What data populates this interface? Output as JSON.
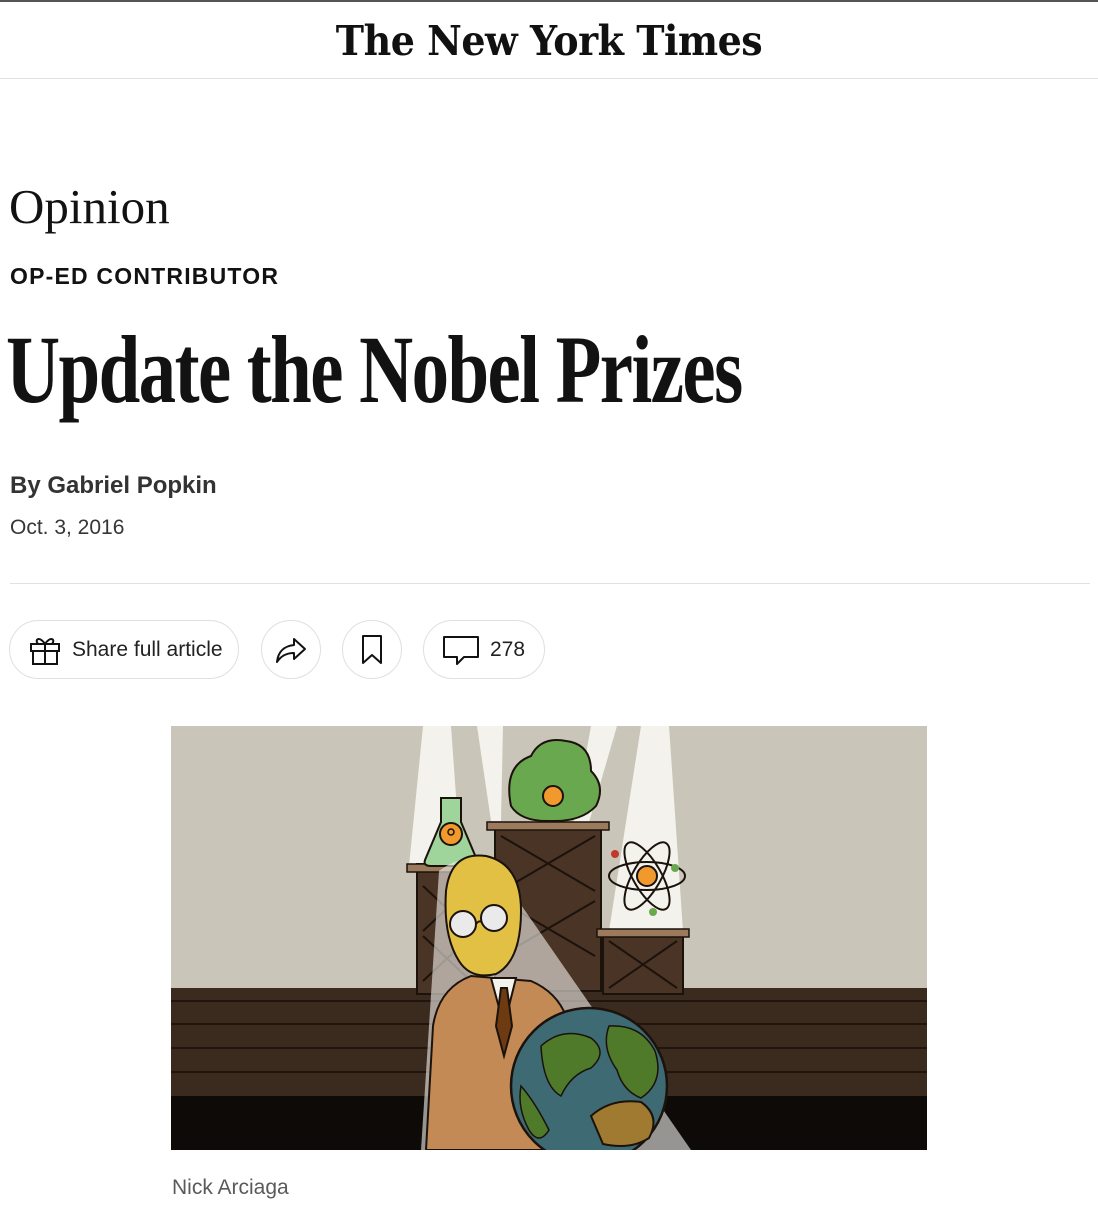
{
  "masthead": {
    "logo_text": "The New York Times"
  },
  "article": {
    "kicker": "Opinion",
    "section": "OP-ED CONTRIBUTOR",
    "headline": "Update the Nobel Prizes",
    "byline": "By Gabriel Popkin",
    "date": "Oct. 3, 2016"
  },
  "toolbar": {
    "share_label": "Share full article",
    "comment_count": "278",
    "icons": [
      "gift-icon",
      "share-arrow-icon",
      "bookmark-icon",
      "comment-icon"
    ]
  },
  "image": {
    "credit": "Nick Arciaga",
    "description_icon": "illustration"
  },
  "colors": {
    "text": "#121212",
    "divider": "#e2e2e2",
    "wall": "#c9c5b8",
    "floor": "#3b2a1e",
    "earth_ocean": "#3d6a73",
    "earth_land": "#4f7a2a",
    "suit": "#c48a55"
  }
}
